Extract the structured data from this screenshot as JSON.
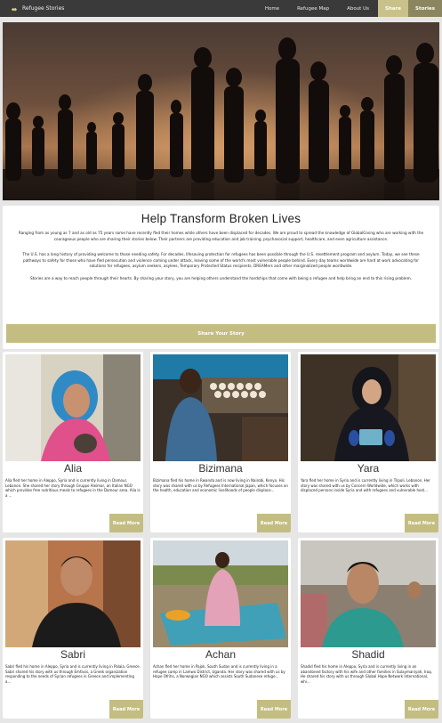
{
  "navbar": {
    "brand": "Refugee Stories",
    "links": [
      "Home",
      "Refugee Map",
      "About Us"
    ],
    "share": "Share",
    "stories": "Stories"
  },
  "intro": {
    "title": "Help Transform Broken Lives",
    "p1": "Ranging from as young as 7 and as old as 75 years some have recently fled their homes while others have been displaced for decades. We are proud to spread the knowledge of GlobalGiving who are working with the courageous people who are sharing their stories below. Their partners are providing education and job training, psychosocial support, healthcare, and even agriculture assistance.",
    "p2": "The U.S. has a long history of providing welcome to those needing safety. For decades, lifesaving protection for refugees has been possible through the U.S. resettlement program and asylum. Today, we see these pathways to safety for those who have fled persecution and violence coming under attack, leaving some of the world's most vulnerable people behind. Every day teams worldwide are hard at work advocating for solutions for refugees, asylum seekers, asylees, Temporary Protected Status recipients, DREAMers and other marginalized people worldwide.",
    "p3": "Stories are a way to reach people through their hearts. By sharing your story, you are helping others understand the hardships that come with being a refugee and help bring an end to this rising problem.",
    "button": "Share Your Story"
  },
  "cards": [
    {
      "name": "Alia",
      "desc": "Alia fled her home in Aleppo, Syria and is currently living in Damour, Lebanon. She shared her story through Gruppo Aleimar, an Italian NGO which provides free nutritious meals to refugees in the Damour area. Alia is a ...",
      "read_more": "Read More"
    },
    {
      "name": "Bizimana",
      "desc": "Bizimana fled his home in Rwanda and is now living in Nairobi, Kenya. His story was shared with us by Refugees International Japan, which focuses on the health, education and economic livelihoods of people displace...",
      "read_more": "Read More"
    },
    {
      "name": "Yara",
      "desc": "Yara fled her home in Syria and is currently living in Tripoli, Lebanon. Her story was shared with us by Concern Worldwide, which works with displaced persons inside Syria and with refugees and vulnerable host...",
      "read_more": "Read More"
    },
    {
      "name": "Sabri",
      "desc": "Sabri fled his home in Aleppo, Syria and is currently living in Palaia, Greece. Sabri shared his story with us through Emfasis, a Greek organization responding to the needs of Syrian refugees in Greece and implementing a...",
      "read_more": "Read More"
    },
    {
      "name": "Achan",
      "desc": "Achan fled her home in Pajok, South Sudan and is currently living in a refugee camp in Lamwo District, Uganda. Her story was shared with us by Hope Ofrihs, a Norwegian NGO which assists South Sudanese refuge...",
      "read_more": "Read More"
    },
    {
      "name": "Shadid",
      "desc": "Shadid fled his home in Aleppo, Syria and is currently living in an abandoned factory with his wife and other families in Sulaymaniyah, Iraq. He shared his story with us through Global Hope Network International, whi...",
      "read_more": "Read More"
    }
  ],
  "colors": {
    "navbar": "#3a3a3a",
    "accent": "#c4bd82",
    "stories_tab": "#8c8660",
    "background": "#e6e6e6"
  },
  "icons": {
    "brand": "handshake-icon"
  }
}
